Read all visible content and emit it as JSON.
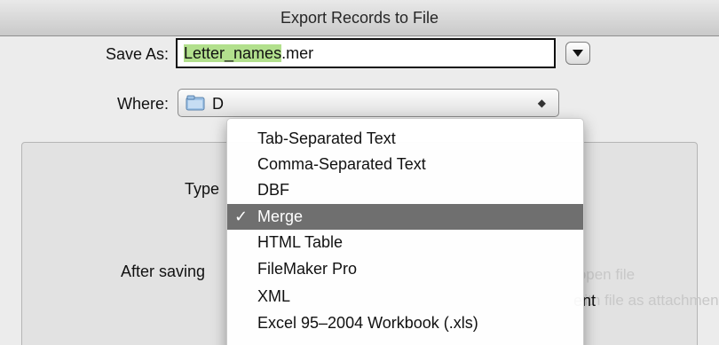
{
  "dialog": {
    "title": "Export Records to File"
  },
  "save_as": {
    "label": "Save As:",
    "filename_selected": "Letter_names",
    "filename_ext": ".mer"
  },
  "where": {
    "label": "Where:",
    "value_partial": "D"
  },
  "options": {
    "type_label_partial": "Type",
    "after_saving_label_partial": "After saving",
    "faint_line_1": "Automatically open file",
    "faint_line_2": "Create email with file as attachment",
    "visible_suffix": "ent"
  },
  "file_type_menu": {
    "selected_value": "Merge",
    "check_glyph": "✓",
    "items": [
      {
        "label": "Tab-Separated Text"
      },
      {
        "label": "Comma-Separated Text"
      },
      {
        "label": "DBF"
      },
      {
        "label": "Merge"
      },
      {
        "label": "HTML Table"
      },
      {
        "label": "FileMaker Pro"
      },
      {
        "label": "XML"
      },
      {
        "label": "Excel 95–2004 Workbook (.xls)"
      }
    ]
  },
  "colors": {
    "selection_highlight": "#b2e08d",
    "menu_selected_bg": "#6f6f6f"
  }
}
